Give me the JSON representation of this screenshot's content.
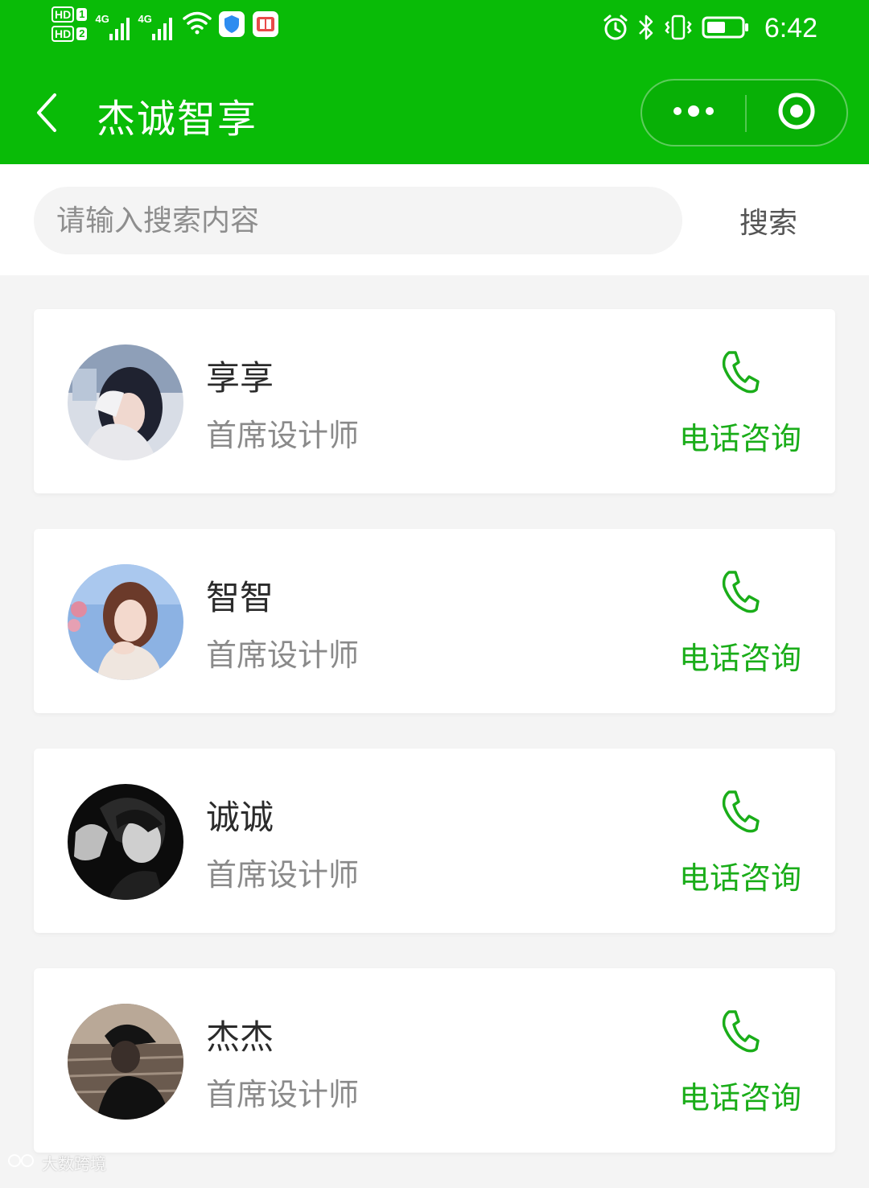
{
  "status_bar": {
    "sim1_badge": "HD",
    "sim1_num": "1",
    "sim2_badge": "HD",
    "sim2_num": "2",
    "network1": "4G",
    "network2": "4G",
    "time": "6:42",
    "icons": [
      "wifi-icon",
      "shield-app-icon",
      "book-app-icon",
      "alarm-icon",
      "bluetooth-icon",
      "vibrate-icon",
      "battery-icon"
    ]
  },
  "nav": {
    "title": "杰诚智享",
    "back_icon": "chevron-left-icon",
    "more_icon": "more-dots-icon",
    "close_icon": "target-close-icon"
  },
  "search": {
    "placeholder": "请输入搜索内容",
    "value": "",
    "button_label": "搜索"
  },
  "designers": [
    {
      "name": "享享",
      "role": "首席设计师",
      "action": "电话咨询"
    },
    {
      "name": "智智",
      "role": "首席设计师",
      "action": "电话咨询"
    },
    {
      "name": "诚诚",
      "role": "首席设计师",
      "action": "电话咨询"
    },
    {
      "name": "杰杰",
      "role": "首席设计师",
      "action": "电话咨询"
    }
  ],
  "colors": {
    "brand_green": "#09bb07",
    "action_green": "#1aad19",
    "background": "#f4f4f4"
  },
  "watermark": "大数跨境"
}
